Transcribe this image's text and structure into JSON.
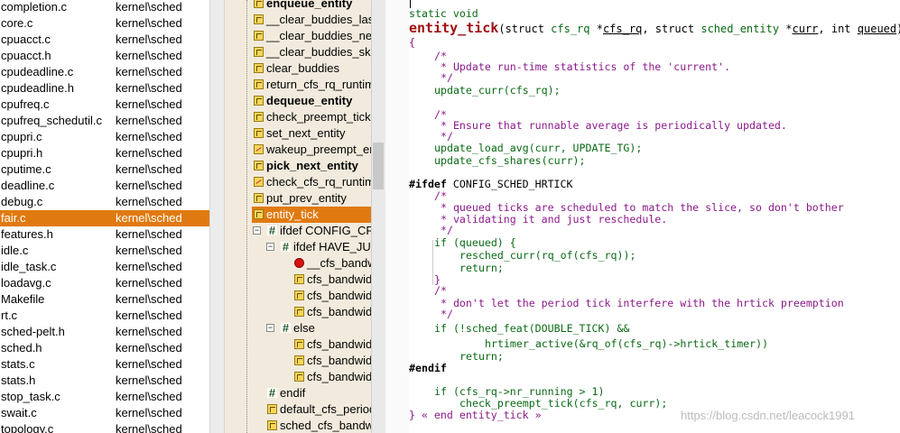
{
  "file_list": {
    "rows": [
      {
        "name": "completion.c",
        "path": "kernel\\sched"
      },
      {
        "name": "core.c",
        "path": "kernel\\sched"
      },
      {
        "name": "cpuacct.c",
        "path": "kernel\\sched"
      },
      {
        "name": "cpuacct.h",
        "path": "kernel\\sched"
      },
      {
        "name": "cpudeadline.c",
        "path": "kernel\\sched"
      },
      {
        "name": "cpudeadline.h",
        "path": "kernel\\sched"
      },
      {
        "name": "cpufreq.c",
        "path": "kernel\\sched"
      },
      {
        "name": "cpufreq_schedutil.c",
        "path": "kernel\\sched"
      },
      {
        "name": "cpupri.c",
        "path": "kernel\\sched"
      },
      {
        "name": "cpupri.h",
        "path": "kernel\\sched"
      },
      {
        "name": "cputime.c",
        "path": "kernel\\sched"
      },
      {
        "name": "deadline.c",
        "path": "kernel\\sched"
      },
      {
        "name": "debug.c",
        "path": "kernel\\sched"
      },
      {
        "name": "fair.c",
        "path": "kernel\\sched",
        "selected": true
      },
      {
        "name": "features.h",
        "path": "kernel\\sched"
      },
      {
        "name": "idle.c",
        "path": "kernel\\sched"
      },
      {
        "name": "idle_task.c",
        "path": "kernel\\sched"
      },
      {
        "name": "loadavg.c",
        "path": "kernel\\sched"
      },
      {
        "name": "Makefile",
        "path": "kernel\\sched"
      },
      {
        "name": "rt.c",
        "path": "kernel\\sched"
      },
      {
        "name": "sched-pelt.h",
        "path": "kernel\\sched"
      },
      {
        "name": "sched.h",
        "path": "kernel\\sched"
      },
      {
        "name": "stats.c",
        "path": "kernel\\sched"
      },
      {
        "name": "stats.h",
        "path": "kernel\\sched"
      },
      {
        "name": "stop_task.c",
        "path": "kernel\\sched"
      },
      {
        "name": "swait.c",
        "path": "kernel\\sched"
      },
      {
        "name": "topology.c",
        "path": "kernel\\sched"
      }
    ]
  },
  "symbol_tree": {
    "items": [
      {
        "label": "enqueue_entity",
        "icon": "function-icon",
        "bold": true
      },
      {
        "label": "__clear_buddies_last",
        "icon": "function-icon"
      },
      {
        "label": "__clear_buddies_next",
        "icon": "function-icon"
      },
      {
        "label": "__clear_buddies_skip",
        "icon": "function-icon"
      },
      {
        "label": "clear_buddies",
        "icon": "function-icon"
      },
      {
        "label": "return_cfs_rq_runtime",
        "icon": "function-icon"
      },
      {
        "label": "dequeue_entity",
        "icon": "function-icon",
        "bold": true
      },
      {
        "label": "check_preempt_tick",
        "icon": "function-icon"
      },
      {
        "label": "set_next_entity",
        "icon": "function-icon"
      },
      {
        "label": "wakeup_preempt_entity",
        "icon": "function-prototype-icon"
      },
      {
        "label": "pick_next_entity",
        "icon": "function-icon",
        "bold": true
      },
      {
        "label": "check_cfs_rq_runtime",
        "icon": "function-prototype-icon"
      },
      {
        "label": "put_prev_entity",
        "icon": "function-icon"
      },
      {
        "label": "entity_tick",
        "icon": "function-icon",
        "selected": true
      },
      {
        "label": "ifdef CONFIG_CFS_BANDWIDTH",
        "icon": "preprocessor-icon",
        "expander": "minus"
      },
      {
        "label": "ifdef HAVE_JUMP_LABEL",
        "icon": "preprocessor-icon",
        "expander": "minus"
      },
      {
        "label": "__cfs_bandwidth_used",
        "icon": "error-icon"
      },
      {
        "label": "cfs_bandwidth_usage_inc",
        "icon": "function-icon"
      },
      {
        "label": "cfs_bandwidth_usage_dec",
        "icon": "function-icon"
      },
      {
        "label": "cfs_bandwidth_used",
        "icon": "function-icon"
      },
      {
        "label": "else",
        "icon": "preprocessor-icon",
        "expander": "minus"
      },
      {
        "label": "cfs_bandwidth_used",
        "icon": "function-icon"
      },
      {
        "label": "cfs_bandwidth_usage_inc",
        "icon": "function-icon"
      },
      {
        "label": "cfs_bandwidth_usage_dec",
        "icon": "function-icon"
      },
      {
        "label": "endif",
        "icon": "preprocessor-icon"
      },
      {
        "label": "default_cfs_period",
        "icon": "function-icon"
      },
      {
        "label": "sched_cfs_bandwidth_slice",
        "icon": "function-icon"
      }
    ]
  },
  "code": {
    "static_void": "static void",
    "func_name": "entity_tick",
    "params_1": "(struct ",
    "params_type1": "cfs_rq",
    "params_2": " *",
    "params_p1": "cfs_rq",
    "params_3": ", struct ",
    "params_type2": "sched_entity",
    "params_4": " *",
    "params_p2": "curr",
    "params_5": ", int ",
    "params_p3": "queued",
    "params_6": ")",
    "open_brace": "{",
    "c1a": "/*",
    "c1b": " * Update run-time statistics of the 'current'.",
    "c1c": " */",
    "l_update_curr": "update_curr(cfs_rq);",
    "c2a": "/*",
    "c2b": " * Ensure that runnable average is periodically updated.",
    "c2c": " */",
    "l_update_load": "update_load_avg(curr, UPDATE_TG);",
    "l_update_shares": "update_cfs_shares(curr);",
    "ifdef_kw": "#ifdef",
    "ifdef_sym": " CONFIG_SCHED_HRTICK",
    "c3a": "/*",
    "c3b": " * queued ticks are scheduled to match the slice, so don't bother",
    "c3c": " * validating it and just reschedule.",
    "c3d": " */",
    "l_if_queued": "if (queued) {",
    "l_resched": "resched_curr(rq_of(cfs_rq));",
    "l_return1": "return;",
    "l_close1": "}",
    "c4a": "/*",
    "c4b": " * don't let the period tick interfere with the hrtick preemption",
    "c4c": " */",
    "l_if_feat": "if (!sched_feat(DOUBLE_TICK) &&",
    "l_hrtimer": "hrtimer_active(&rq_of(cfs_rq)->hrtick_timer))",
    "l_return2": "return;",
    "endif": "#endif",
    "l_if_running": "if (cfs_rq->nr_running > 1)",
    "l_check": "check_preempt_tick(cfs_rq, curr);",
    "close_brace": "}",
    "end_comment": " « end entity_tick »"
  },
  "watermark": "https://blog.csdn.net/leacock1991"
}
